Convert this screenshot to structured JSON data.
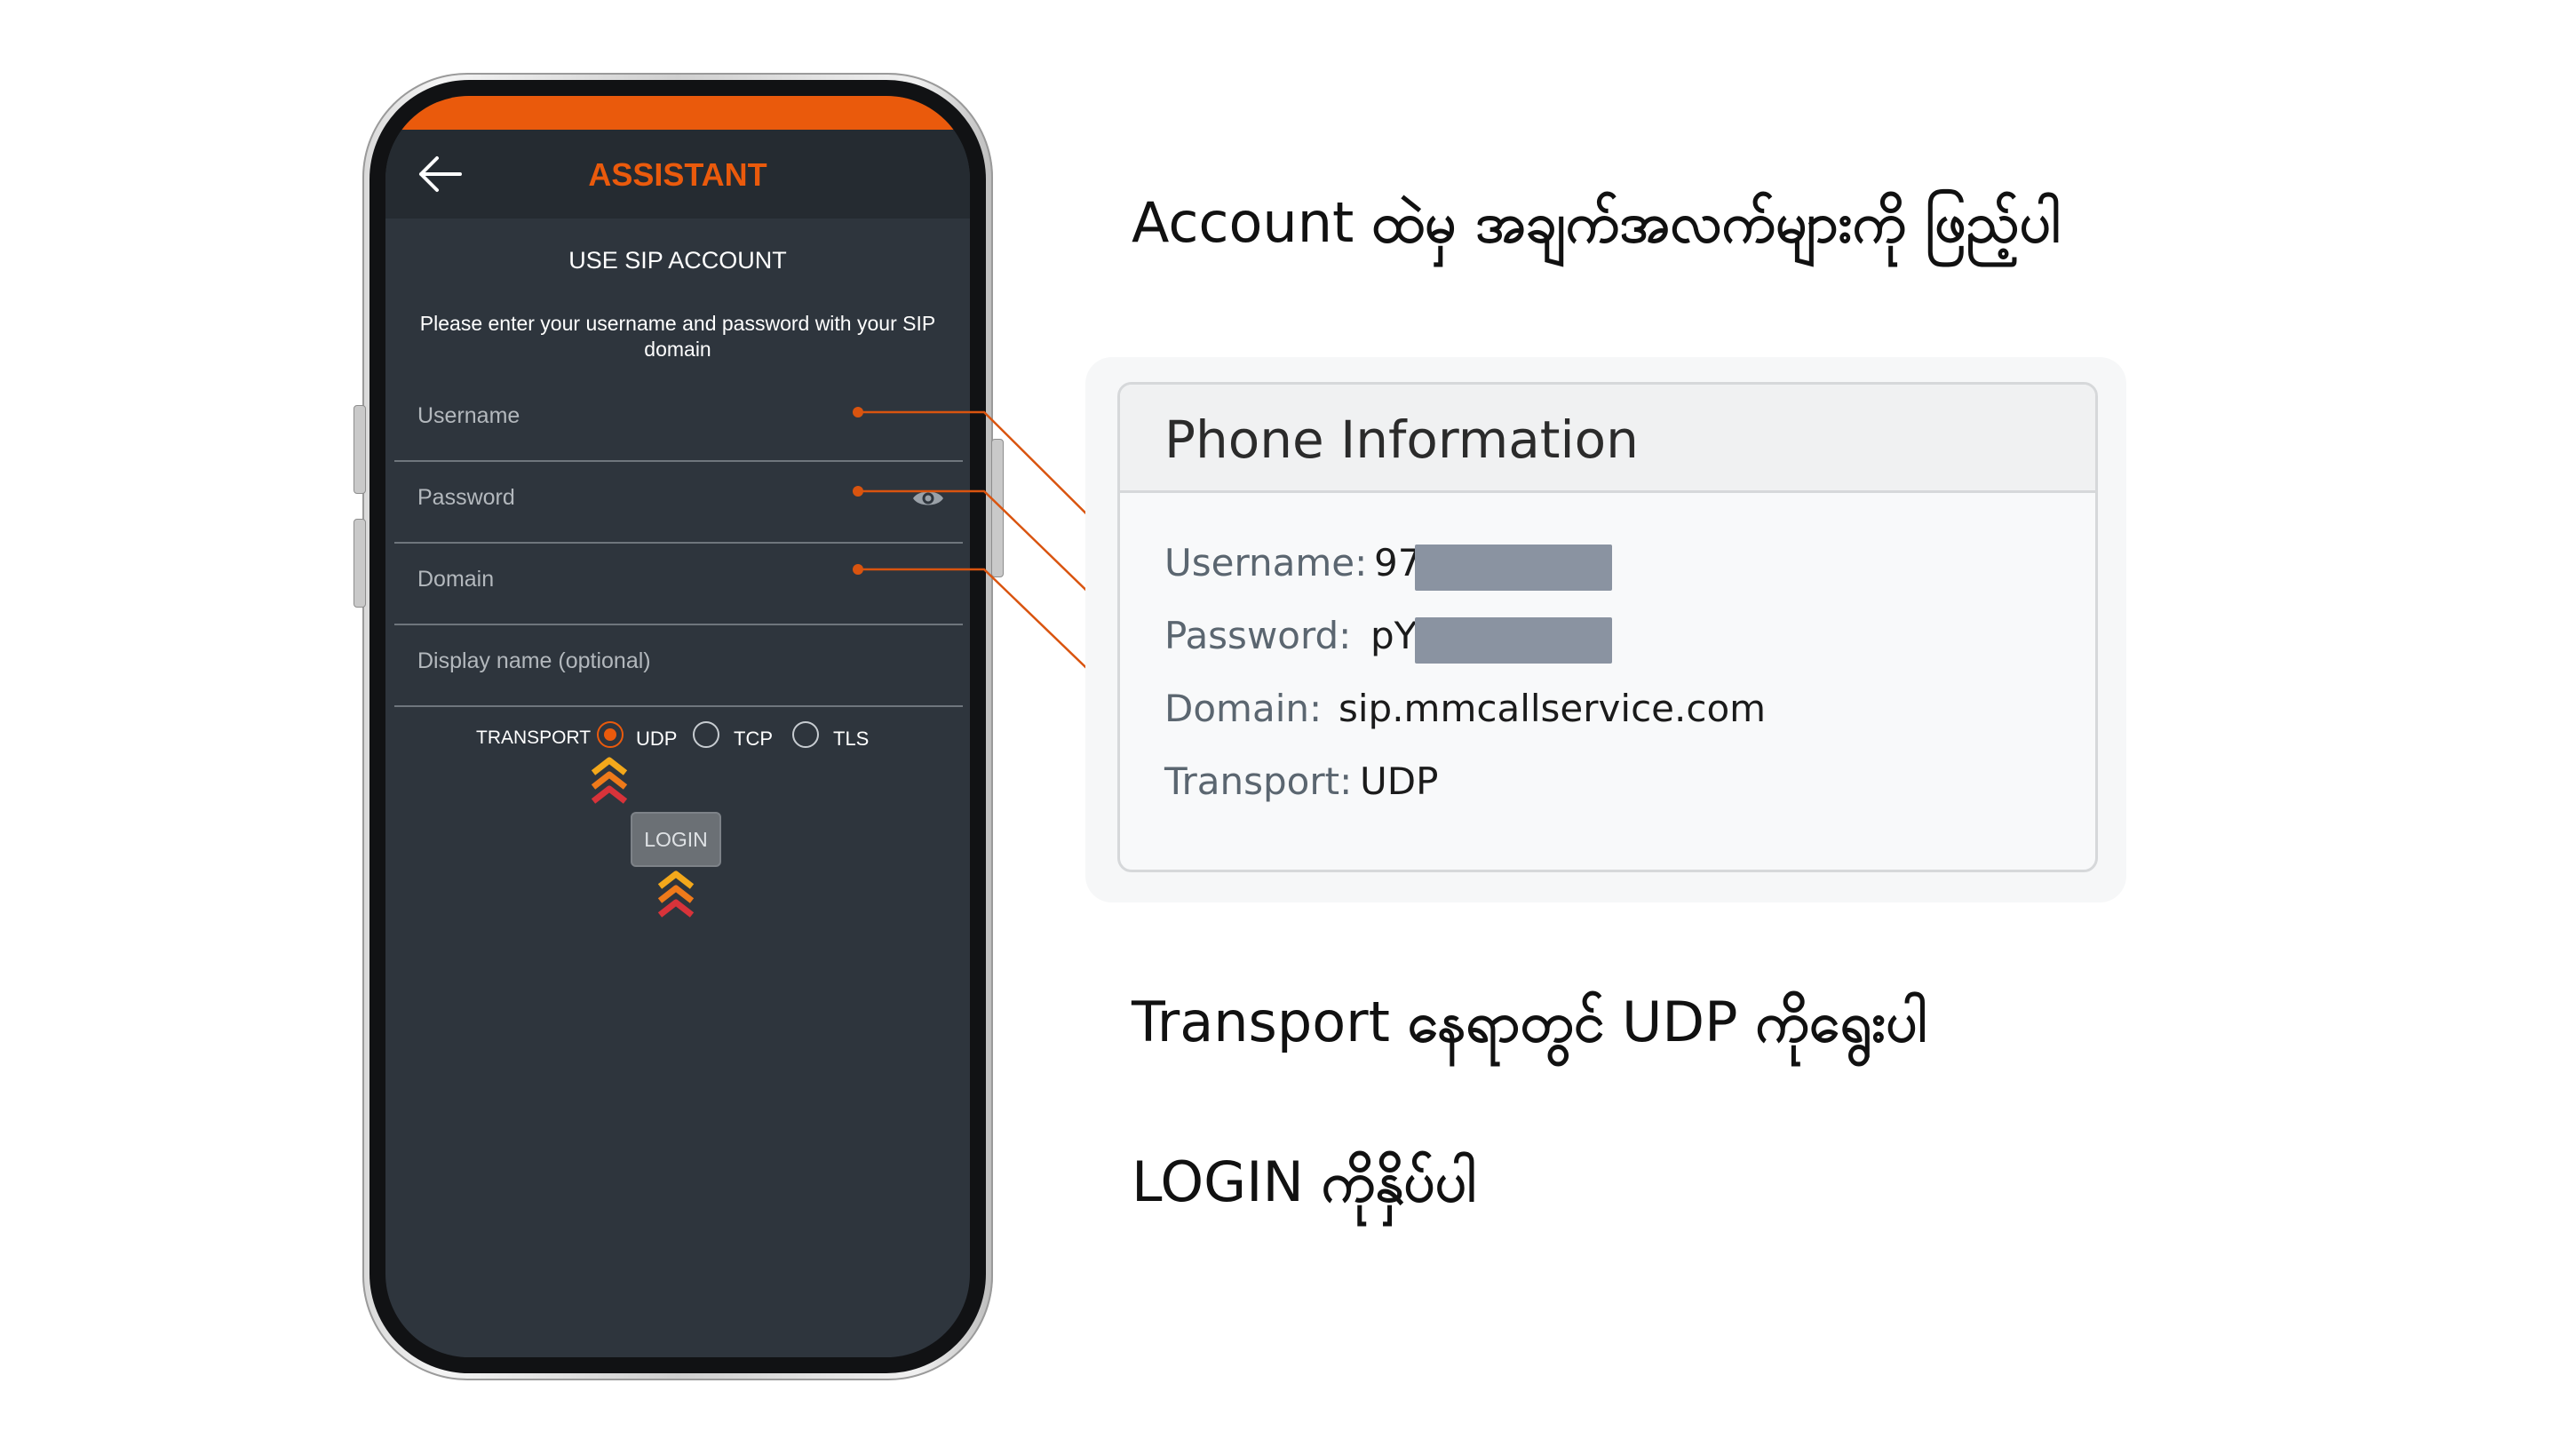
{
  "phone": {
    "app_title": "ASSISTANT",
    "section_title": "USE SIP ACCOUNT",
    "instructions": "Please enter your username and password with your SIP domain",
    "fields": {
      "username": "Username",
      "password": "Password",
      "domain": "Domain",
      "display_name": "Display name (optional)"
    },
    "transport": {
      "label": "TRANSPORT",
      "options": [
        "UDP",
        "TCP",
        "TLS"
      ],
      "selected": "UDP"
    },
    "login_label": "LOGIN"
  },
  "instructions_text": {
    "step1_en": "Account",
    "step1_mm": "ထဲမှ အချက်အလက်များကို ဖြည့်ပါ",
    "step2_en1": "Transport",
    "step2_mm1": "နေရာတွင်",
    "step2_en2": "UDP",
    "step2_mm2": "ကိုရွေးပါ",
    "step3_en": "LOGIN",
    "step3_mm": "ကိုနှိပ်ပါ"
  },
  "phone_info": {
    "title": "Phone Information",
    "username_key": "Username:",
    "username_val": "97",
    "password_key": "Password:",
    "password_val": "pY",
    "domain_key": "Domain:",
    "domain_val": "sip.mmcallservice.com",
    "transport_key": "Transport:",
    "transport_val": "UDP"
  },
  "colors": {
    "accent": "#ea5a0c",
    "screen_bg": "#2e353d",
    "topbar_bg": "#252b31",
    "redaction": "#8a93a1"
  }
}
